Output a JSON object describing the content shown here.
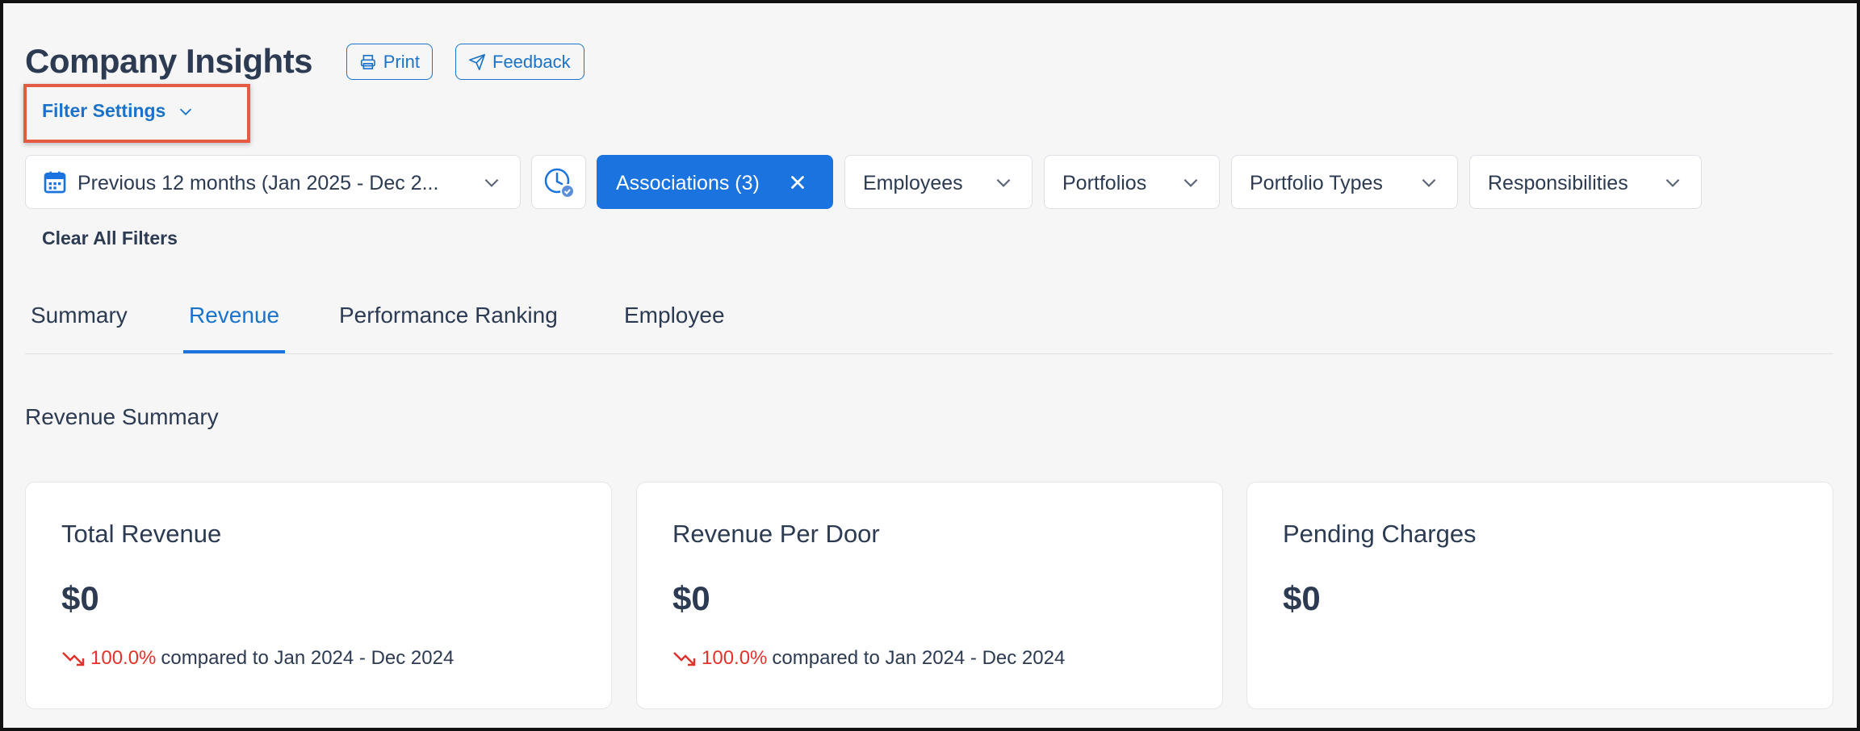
{
  "header": {
    "title": "Company Insights",
    "print_label": "Print",
    "feedback_label": "Feedback"
  },
  "filter_settings": {
    "label": "Filter Settings"
  },
  "filters": {
    "date_range": "Previous 12 months (Jan 2025 - Dec 2...",
    "associations": "Associations (3)",
    "employees": "Employees",
    "portfolios": "Portfolios",
    "portfolio_types": "Portfolio Types",
    "responsibilities": "Responsibilities",
    "clear_all": "Clear All Filters"
  },
  "tabs": [
    {
      "label": "Summary",
      "active": false
    },
    {
      "label": "Revenue",
      "active": true
    },
    {
      "label": "Performance Ranking",
      "active": false
    },
    {
      "label": "Employee",
      "active": false
    }
  ],
  "section": {
    "title": "Revenue Summary"
  },
  "cards": [
    {
      "title": "Total Revenue",
      "value": "$0",
      "change": "100.0%",
      "compare": "compared to Jan 2024 - Dec 2024",
      "trend": "down"
    },
    {
      "title": "Revenue Per Door",
      "value": "$0",
      "change": "100.0%",
      "compare": "compared to Jan 2024 - Dec 2024",
      "trend": "down"
    },
    {
      "title": "Pending Charges",
      "value": "$0"
    }
  ],
  "colors": {
    "accent": "#1a73de",
    "text": "#2c3a52",
    "negative": "#e0332c",
    "highlight": "#e35a45"
  }
}
